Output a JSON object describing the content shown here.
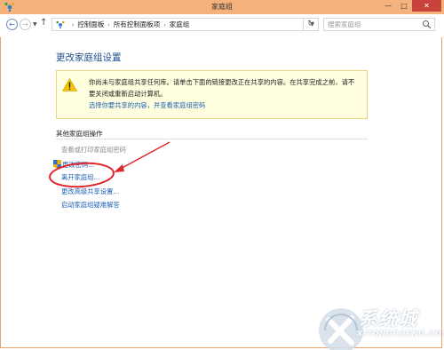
{
  "window": {
    "title": "家庭组",
    "controls": {
      "minimize": "—",
      "maximize": "□",
      "close": "✕"
    }
  },
  "nav": {
    "back_icon": "arrow-left-icon",
    "forward_icon": "arrow-right-icon",
    "recent_icon": "chevron-down-icon",
    "up_icon": "arrow-up-icon",
    "breadcrumbs": [
      "控制面板",
      "所有控制面板项",
      "家庭组"
    ],
    "search_placeholder": "搜索家庭组"
  },
  "main": {
    "heading": "更改家庭组设置",
    "warning": {
      "text": "你尚未与家庭组共享任何库。请单击下面的链接更改正在共享的内容。在共享完成之前，请不要关闭或重新启动计算机。",
      "link": "选择你要共享的内容，并查看家庭组密码"
    },
    "other_actions": {
      "title": "其他家庭组操作",
      "items": [
        "查看或打印家庭组密码",
        "更改密码...",
        "离开家庭组...",
        "更改高级共享设置...",
        "启动家庭组疑难解答"
      ]
    }
  },
  "watermark": {
    "text": "系统城",
    "url": "XITONGCHENG.COM"
  },
  "colors": {
    "titlebar": "#f6b27d",
    "link": "#1f5fb4",
    "heading": "#1e4e8c",
    "annotation": "#e0262b"
  }
}
